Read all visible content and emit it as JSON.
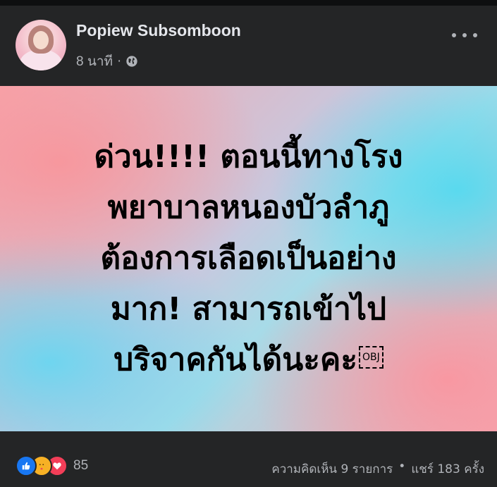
{
  "post": {
    "author": "Popiew Subsomboon",
    "time": "8 นาที",
    "separator": "·",
    "privacy_icon": "globe-icon",
    "more_icon": "more-horizontal-icon"
  },
  "banner": {
    "lines": [
      "ด่วน!!!! ตอนนี้ทางโรง",
      "พยาบาลหนองบัวลำภู",
      "ต้องการเลือดเป็นอย่าง",
      "มาก! สามารถเข้าไป",
      "บริจาคกันได้นะคะ"
    ],
    "obj_glyph": "OBJ",
    "colors": {
      "pink": "#f7a6ac",
      "cyan": "#50daf0",
      "text": "#000000"
    }
  },
  "footer": {
    "reaction_icons": [
      "like-icon",
      "care-icon",
      "love-icon"
    ],
    "reaction_count": "85",
    "comments": "ความคิดเห็น 9 รายการ",
    "dot": "•",
    "shares": "แชร์ 183 ครั้ง"
  },
  "theme": {
    "background": "#242526",
    "text_primary": "#e4e6eb",
    "text_secondary": "#b0b3b8"
  }
}
